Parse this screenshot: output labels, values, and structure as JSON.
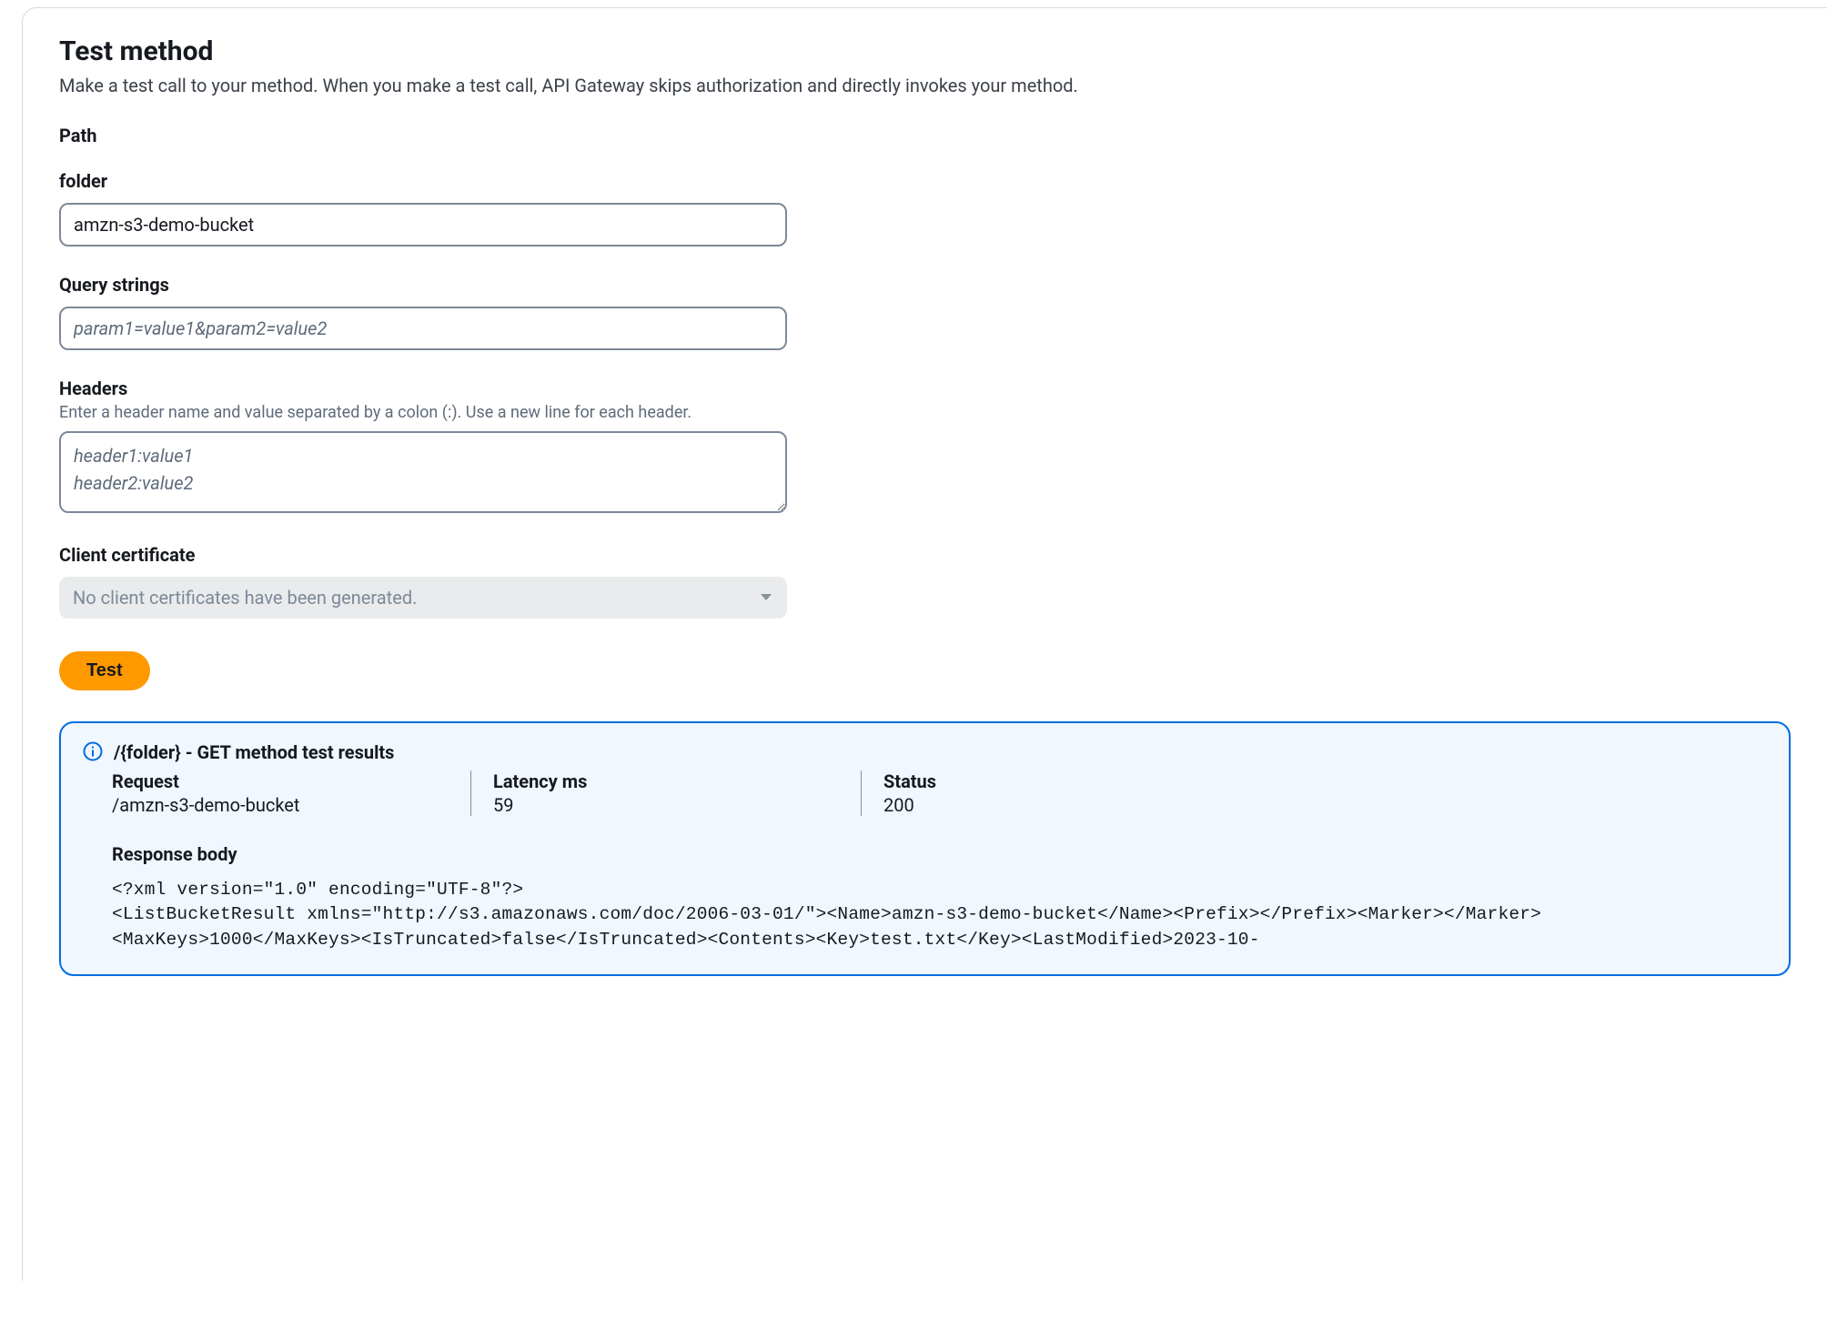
{
  "header": {
    "title": "Test method",
    "subtitle": "Make a test call to your method. When you make a test call, API Gateway skips authorization and directly invokes your method."
  },
  "form": {
    "path_label": "Path",
    "folder_label": "folder",
    "folder_value": "amzn-s3-demo-bucket",
    "query_label": "Query strings",
    "query_placeholder": "param1=value1&param2=value2",
    "query_value": "",
    "headers_label": "Headers",
    "headers_hint": "Enter a header name and value separated by a colon (:). Use a new line for each header.",
    "headers_placeholder": "header1:value1\nheader2:value2",
    "headers_value": "",
    "cert_label": "Client certificate",
    "cert_placeholder": "No client certificates have been generated.",
    "test_button": "Test"
  },
  "results": {
    "title": "/{folder} - GET method test results",
    "request_label": "Request",
    "request_value": "/amzn-s3-demo-bucket",
    "latency_label": "Latency ms",
    "latency_value": "59",
    "status_label": "Status",
    "status_value": "200",
    "response_body_label": "Response body",
    "response_body_text": "<?xml version=\"1.0\" encoding=\"UTF-8\"?>\n<ListBucketResult xmlns=\"http://s3.amazonaws.com/doc/2006-03-01/\"><Name>amzn-s3-demo-bucket</Name><Prefix></Prefix><Marker></Marker><MaxKeys>1000</MaxKeys><IsTruncated>false</IsTruncated><Contents><Key>test.txt</Key><LastModified>2023-10-"
  }
}
